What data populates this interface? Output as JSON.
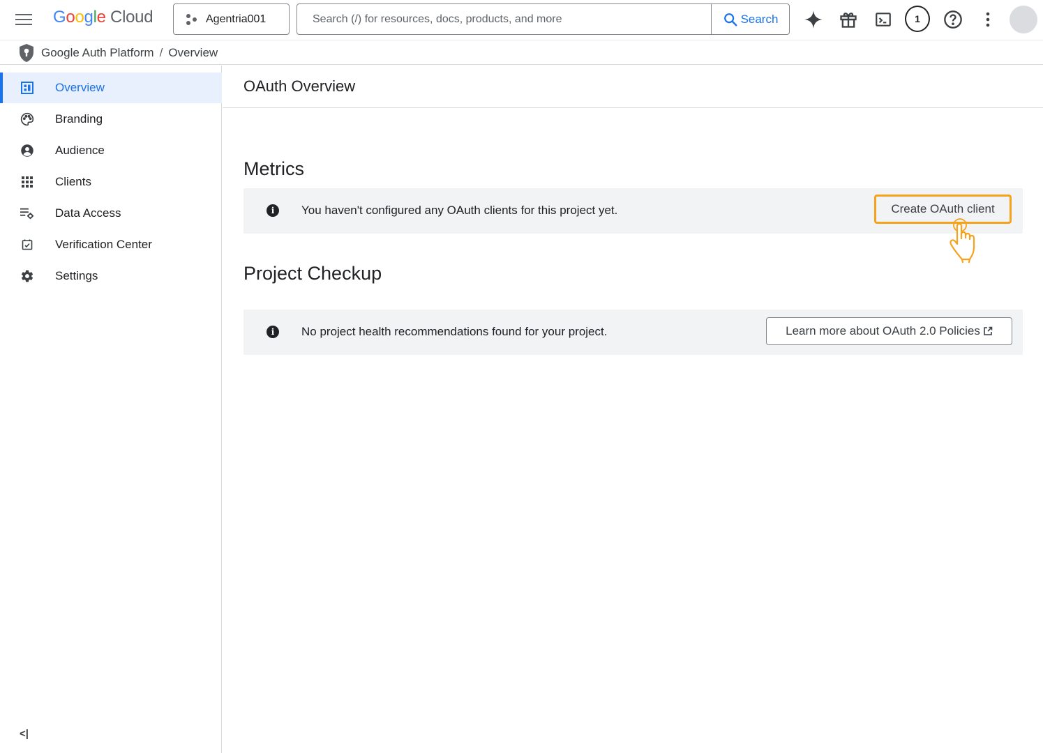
{
  "topbar": {
    "logo": {
      "g": "G",
      "o1": "o",
      "o2": "o",
      "g2": "g",
      "l": "l",
      "e": "e",
      "cloud": "Cloud"
    },
    "project": "Agentria001",
    "search_placeholder": "Search (/) for resources, docs, products, and more",
    "search_button": "Search",
    "notification_count": "1",
    "icons": [
      "gemini-spark-icon",
      "gift-icon",
      "cloud-shell-icon",
      "notifications-icon",
      "help-icon",
      "more-vert-icon"
    ]
  },
  "breadcrumb": {
    "product": "Google Auth Platform",
    "separator": "/",
    "page": "Overview"
  },
  "sidebar": {
    "items": [
      {
        "label": "Overview",
        "icon": "dashboard-icon",
        "active": true
      },
      {
        "label": "Branding",
        "icon": "palette-icon",
        "active": false
      },
      {
        "label": "Audience",
        "icon": "account-circle-icon",
        "active": false
      },
      {
        "label": "Clients",
        "icon": "apps-grid-icon",
        "active": false
      },
      {
        "label": "Data Access",
        "icon": "list-settings-icon",
        "active": false
      },
      {
        "label": "Verification Center",
        "icon": "checkbox-icon",
        "active": false
      },
      {
        "label": "Settings",
        "icon": "gear-icon",
        "active": false
      }
    ],
    "collapse_label": "<|"
  },
  "main": {
    "page_title": "OAuth Overview",
    "metrics": {
      "title": "Metrics",
      "message": "You haven't configured any OAuth clients for this project yet.",
      "button": "Create OAuth client"
    },
    "checkup": {
      "title": "Project Checkup",
      "message": "No project health recommendations found for your project.",
      "button": "Learn more about OAuth 2.0 Policies"
    }
  },
  "colors": {
    "accent": "#1a73e8",
    "highlight": "#f7a21b",
    "card_bg": "#f1f3f4",
    "active_nav_bg": "#e8f0fe"
  }
}
